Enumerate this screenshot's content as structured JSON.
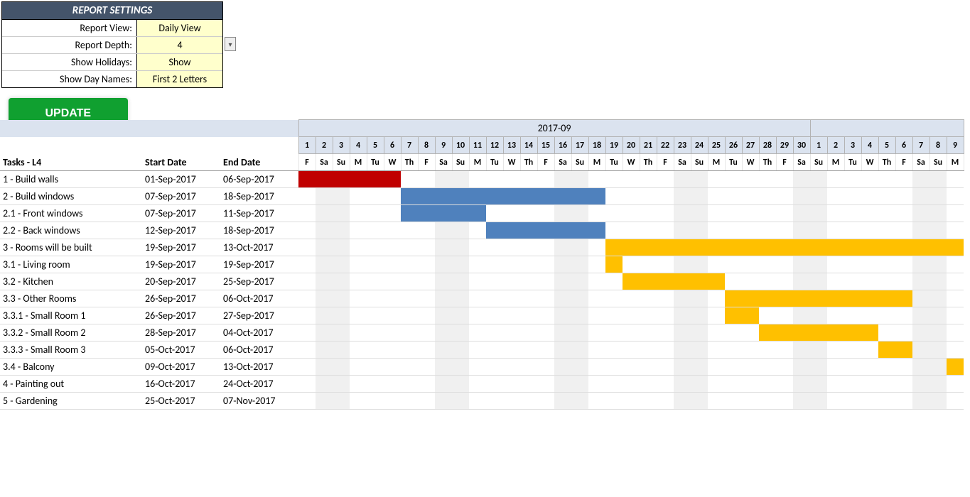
{
  "settings": {
    "title": "REPORT SETTINGS",
    "rows": [
      {
        "label": "Report View:",
        "value": "Daily View"
      },
      {
        "label": "Report Depth:",
        "value": "4"
      },
      {
        "label": "Show Holidays:",
        "value": "Show"
      },
      {
        "label": "Show Day Names:",
        "value": "First 2 Letters"
      }
    ]
  },
  "update_button": "UPDATE\nGANTT CHART",
  "columns": {
    "task": "Tasks - L4",
    "start": "Start Date",
    "end": "End Date"
  },
  "month_label_1": "2017-09",
  "month_label_2": "",
  "timeline": {
    "days": [
      1,
      2,
      3,
      4,
      5,
      6,
      7,
      8,
      9,
      10,
      11,
      12,
      13,
      14,
      15,
      16,
      17,
      18,
      19,
      20,
      21,
      22,
      23,
      24,
      25,
      26,
      27,
      28,
      29,
      30,
      1,
      2,
      3,
      4,
      5,
      6,
      7,
      8,
      9
    ],
    "dow": [
      "F",
      "Sa",
      "Su",
      "M",
      "Tu",
      "W",
      "Th",
      "F",
      "Sa",
      "Su",
      "M",
      "Tu",
      "W",
      "Th",
      "F",
      "Sa",
      "Su",
      "M",
      "Tu",
      "W",
      "Th",
      "F",
      "Sa",
      "Su",
      "M",
      "Tu",
      "W",
      "Th",
      "F",
      "Sa",
      "Su",
      "M",
      "Tu",
      "W",
      "Th",
      "F",
      "Sa",
      "Su",
      "M"
    ],
    "weekend_idx": [
      1,
      2,
      8,
      9,
      15,
      16,
      22,
      23,
      29,
      30,
      36,
      37
    ]
  },
  "tasks": [
    {
      "name": "1 - Build walls",
      "start": "01-Sep-2017",
      "end": "06-Sep-2017",
      "bar_start": 0,
      "bar_end": 5,
      "color": "red"
    },
    {
      "name": "2 - Build windows",
      "start": "07-Sep-2017",
      "end": "18-Sep-2017",
      "bar_start": 6,
      "bar_end": 17,
      "color": "blue"
    },
    {
      "name": "2.1 - Front windows",
      "start": "07-Sep-2017",
      "end": "11-Sep-2017",
      "bar_start": 6,
      "bar_end": 10,
      "color": "blue"
    },
    {
      "name": "2.2 - Back windows",
      "start": "12-Sep-2017",
      "end": "18-Sep-2017",
      "bar_start": 11,
      "bar_end": 17,
      "color": "blue"
    },
    {
      "name": "3 - Rooms will be built",
      "start": "19-Sep-2017",
      "end": "13-Oct-2017",
      "bar_start": 18,
      "bar_end": 38,
      "color": "orange"
    },
    {
      "name": "3.1 - Living room",
      "start": "19-Sep-2017",
      "end": "19-Sep-2017",
      "bar_start": 18,
      "bar_end": 18,
      "color": "orange"
    },
    {
      "name": "3.2 - Kitchen",
      "start": "20-Sep-2017",
      "end": "25-Sep-2017",
      "bar_start": 19,
      "bar_end": 24,
      "color": "orange"
    },
    {
      "name": "3.3 - Other Rooms",
      "start": "26-Sep-2017",
      "end": "06-Oct-2017",
      "bar_start": 25,
      "bar_end": 35,
      "color": "orange"
    },
    {
      "name": "3.3.1 - Small Room 1",
      "start": "26-Sep-2017",
      "end": "27-Sep-2017",
      "bar_start": 25,
      "bar_end": 26,
      "color": "orange"
    },
    {
      "name": "3.3.2 - Small Room 2",
      "start": "28-Sep-2017",
      "end": "04-Oct-2017",
      "bar_start": 27,
      "bar_end": 33,
      "color": "orange"
    },
    {
      "name": "3.3.3 - Small Room 3",
      "start": "05-Oct-2017",
      "end": "06-Oct-2017",
      "bar_start": 34,
      "bar_end": 35,
      "color": "orange"
    },
    {
      "name": "3.4 - Balcony",
      "start": "09-Oct-2017",
      "end": "13-Oct-2017",
      "bar_start": 38,
      "bar_end": 38,
      "color": "orange"
    },
    {
      "name": "4 - Painting out",
      "start": "16-Oct-2017",
      "end": "24-Oct-2017",
      "bar_start": -1,
      "bar_end": -1,
      "color": ""
    },
    {
      "name": "5 - Gardening",
      "start": "25-Oct-2017",
      "end": "07-Nov-2017",
      "bar_start": -1,
      "bar_end": -1,
      "color": ""
    }
  ],
  "chart_data": {
    "type": "gantt",
    "timeline_start": "2017-09-01",
    "timeline_end": "2017-10-09",
    "tasks": [
      {
        "id": "1",
        "name": "Build walls",
        "start": "2017-09-01",
        "end": "2017-09-06",
        "color": "#c00000"
      },
      {
        "id": "2",
        "name": "Build windows",
        "start": "2017-09-07",
        "end": "2017-09-18",
        "color": "#4f81bd"
      },
      {
        "id": "2.1",
        "name": "Front windows",
        "start": "2017-09-07",
        "end": "2017-09-11",
        "color": "#4f81bd"
      },
      {
        "id": "2.2",
        "name": "Back windows",
        "start": "2017-09-12",
        "end": "2017-09-18",
        "color": "#4f81bd"
      },
      {
        "id": "3",
        "name": "Rooms will be built",
        "start": "2017-09-19",
        "end": "2017-10-13",
        "color": "#ffc000"
      },
      {
        "id": "3.1",
        "name": "Living room",
        "start": "2017-09-19",
        "end": "2017-09-19",
        "color": "#ffc000"
      },
      {
        "id": "3.2",
        "name": "Kitchen",
        "start": "2017-09-20",
        "end": "2017-09-25",
        "color": "#ffc000"
      },
      {
        "id": "3.3",
        "name": "Other Rooms",
        "start": "2017-09-26",
        "end": "2017-10-06",
        "color": "#ffc000"
      },
      {
        "id": "3.3.1",
        "name": "Small Room 1",
        "start": "2017-09-26",
        "end": "2017-09-27",
        "color": "#ffc000"
      },
      {
        "id": "3.3.2",
        "name": "Small Room 2",
        "start": "2017-09-28",
        "end": "2017-10-04",
        "color": "#ffc000"
      },
      {
        "id": "3.3.3",
        "name": "Small Room 3",
        "start": "2017-10-05",
        "end": "2017-10-06",
        "color": "#ffc000"
      },
      {
        "id": "3.4",
        "name": "Balcony",
        "start": "2017-10-09",
        "end": "2017-10-13",
        "color": "#ffc000"
      },
      {
        "id": "4",
        "name": "Painting out",
        "start": "2017-10-16",
        "end": "2017-10-24",
        "color": ""
      },
      {
        "id": "5",
        "name": "Gardening",
        "start": "2017-10-25",
        "end": "2017-11-07",
        "color": ""
      }
    ]
  }
}
